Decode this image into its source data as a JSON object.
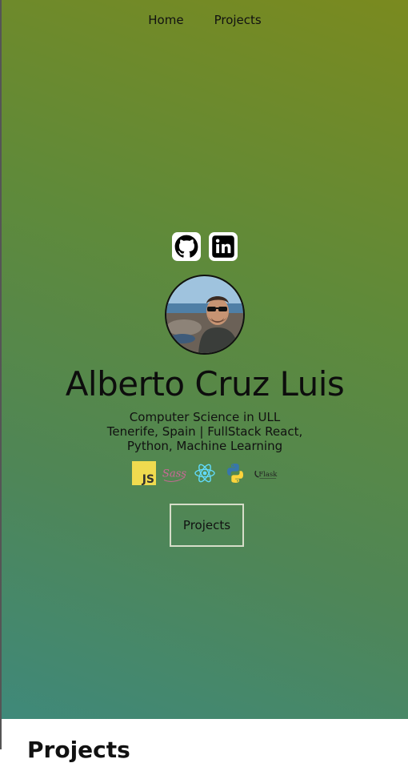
{
  "nav": {
    "items": [
      "Home",
      "Projects"
    ]
  },
  "socials": {
    "icons": [
      "github-icon",
      "linkedin-icon"
    ]
  },
  "profile": {
    "name": "Alberto Cruz Luis",
    "subtitle_line1": "Computer Science in ULL",
    "subtitle_line2": "Tenerife, Spain | FullStack React,",
    "subtitle_line3": "Python, Machine Learning"
  },
  "tech": {
    "js_label": "JS",
    "sass_label": "Sass",
    "flask_label": "Flask",
    "icons": [
      "javascript-icon",
      "sass-icon",
      "react-icon",
      "python-icon",
      "flask-icon"
    ]
  },
  "cta": {
    "label": "Projects"
  },
  "next_section": {
    "title": "Projects"
  },
  "colors": {
    "accent_js": "#f0db4f",
    "sass": "#cd6799",
    "react": "#61dafb",
    "python_blue": "#3776ab",
    "python_yellow": "#ffd43b"
  }
}
